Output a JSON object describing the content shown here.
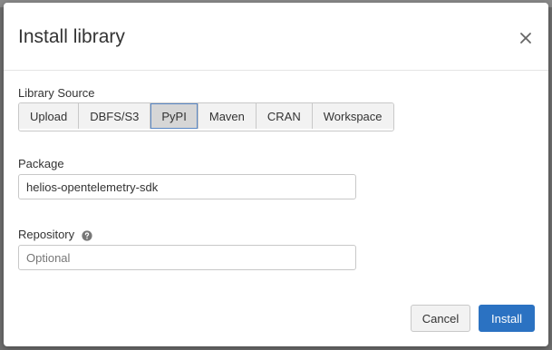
{
  "dialog": {
    "title": "Install library",
    "library_source": {
      "label": "Library Source",
      "options": [
        "Upload",
        "DBFS/S3",
        "PyPI",
        "Maven",
        "CRAN",
        "Workspace"
      ],
      "selected": "PyPI"
    },
    "package": {
      "label": "Package",
      "value": "helios-opentelemetry-sdk"
    },
    "repository": {
      "label": "Repository",
      "placeholder": "Optional",
      "help_icon": "question-circle-icon"
    },
    "buttons": {
      "cancel": "Cancel",
      "install": "Install"
    },
    "close_icon": "close-icon"
  },
  "colors": {
    "primary": "#2b72c2",
    "selected_border": "#5a88c5",
    "backdrop": "#6f6f6f"
  }
}
